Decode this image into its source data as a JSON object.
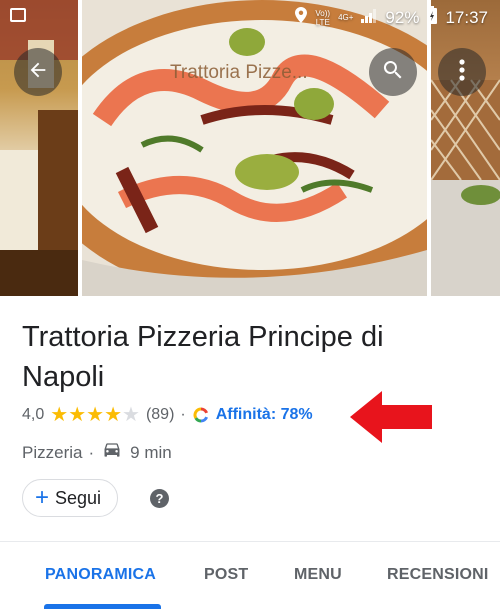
{
  "status_bar": {
    "network_top": "Vo))",
    "network_bottom": "LTE",
    "signal_label": "4G+",
    "battery": "92%",
    "time": "17:37"
  },
  "header": {
    "photo_title": "Trattoria Pizze..."
  },
  "place": {
    "name": "Trattoria Pizzeria Principe di Napoli",
    "rating": "4,0",
    "stars_value": 4.0,
    "review_count": "(89)",
    "separator": "·",
    "affinity": "Affinità: 78%",
    "category": "Pizzeria",
    "drive_time": "9 min"
  },
  "actions": {
    "follow_label": "Segui",
    "help_symbol": "?"
  },
  "tabs": [
    {
      "label": "PANORAMICA",
      "active": true
    },
    {
      "label": "POST",
      "active": false
    },
    {
      "label": "MENU",
      "active": false
    },
    {
      "label": "RECENSIONI",
      "active": false
    }
  ],
  "colors": {
    "accent": "#1a73e8",
    "star": "#fbbc04",
    "annotation_arrow": "#e8141c"
  },
  "icons": [
    "image-icon",
    "location-icon",
    "signal-icon",
    "battery-icon",
    "back-arrow-icon",
    "search-icon",
    "more-vert-icon",
    "star-icon",
    "google-logo-icon",
    "car-icon",
    "plus-icon",
    "help-icon"
  ]
}
